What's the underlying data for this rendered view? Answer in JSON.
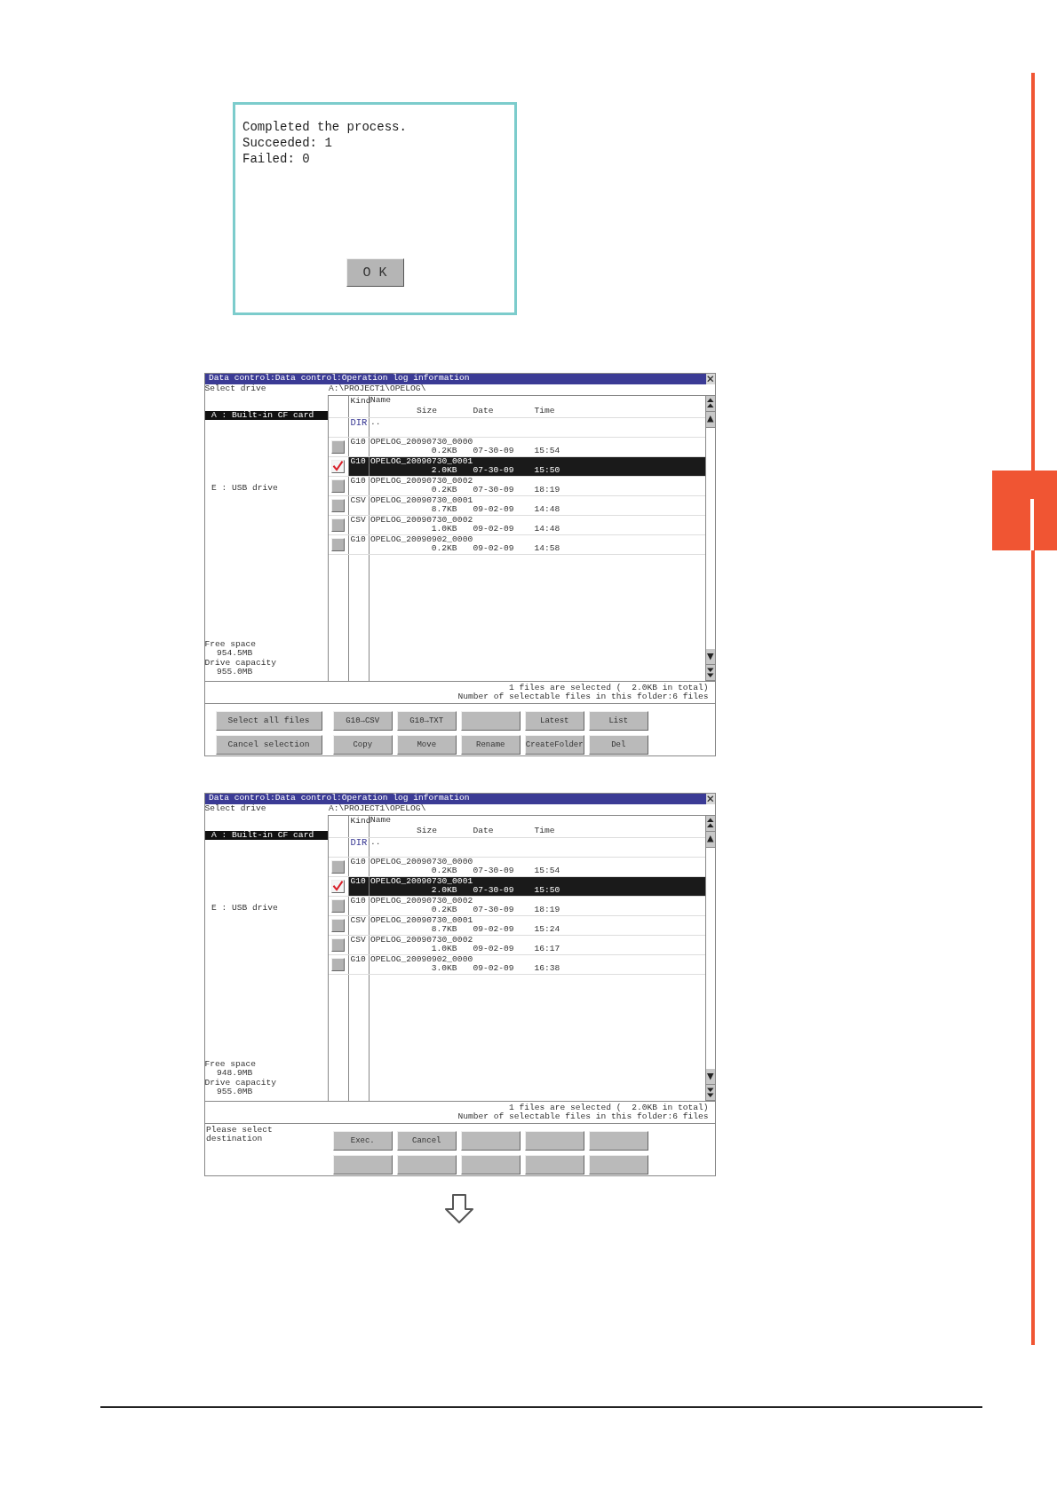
{
  "dialog": {
    "lines": [
      "Completed the process.",
      "Succeeded: 1",
      "Failed: 0"
    ],
    "button": "O K"
  },
  "screens": [
    {
      "title": "Data control:Data control:Operation log information",
      "drive_label": "Select drive",
      "path": "A:\\PROJECT1\\OPELOG\\",
      "drives": [
        {
          "label": "A : Built-in CF card",
          "selected": true
        },
        {
          "label": "E : USB drive",
          "selected": false
        }
      ],
      "free_space_label": "Free space",
      "free_space": "954.5MB",
      "capacity_label": "Drive capacity",
      "capacity": "955.0MB",
      "columns": {
        "kind": "Kind",
        "name": "Name",
        "size": "Size",
        "date": "Date",
        "time": "Time"
      },
      "dir_row": {
        "kind": "DIR",
        "name": ".."
      },
      "files": [
        {
          "kind": "G10",
          "name": "OPELOG_20090730_0000",
          "size": "0.2KB",
          "date": "07-30-09",
          "time": "15:54",
          "checked": false,
          "selected": false
        },
        {
          "kind": "G10",
          "name": "OPELOG_20090730_0001",
          "size": "2.0KB",
          "date": "07-30-09",
          "time": "15:50",
          "checked": true,
          "selected": true
        },
        {
          "kind": "G10",
          "name": "OPELOG_20090730_0002",
          "size": "0.2KB",
          "date": "07-30-09",
          "time": "18:19",
          "checked": false,
          "selected": false
        },
        {
          "kind": "CSV",
          "name": "OPELOG_20090730_0001",
          "size": "8.7KB",
          "date": "09-02-09",
          "time": "14:48",
          "checked": false,
          "selected": false
        },
        {
          "kind": "CSV",
          "name": "OPELOG_20090730_0002",
          "size": "1.0KB",
          "date": "09-02-09",
          "time": "14:48",
          "checked": false,
          "selected": false
        },
        {
          "kind": "G10",
          "name": "OPELOG_20090902_0000",
          "size": "0.2KB",
          "date": "09-02-09",
          "time": "14:58",
          "checked": false,
          "selected": false
        }
      ],
      "status_lines": [
        "1 files are selected (  2.0KB in total)",
        "Number of selectable files in this folder:6 files"
      ],
      "button_rows": [
        [
          {
            "kind": "wide",
            "label": "Select all files"
          },
          {
            "kind": "text",
            "label": "G10→CSV"
          },
          {
            "kind": "text",
            "label": "G10→TXT"
          },
          {
            "kind": "blank"
          },
          {
            "kind": "text",
            "label": "Latest"
          },
          {
            "kind": "text",
            "label": "List"
          }
        ],
        [
          {
            "kind": "wide",
            "label": "Cancel selection"
          },
          {
            "kind": "text",
            "label": "Copy"
          },
          {
            "kind": "text",
            "label": "Move"
          },
          {
            "kind": "text",
            "label": "Rename"
          },
          {
            "kind": "text",
            "label": "CreateFolder"
          },
          {
            "kind": "text",
            "label": "Del"
          }
        ]
      ]
    },
    {
      "title": "Data control:Data control:Operation log information",
      "drive_label": "Select drive",
      "path": "A:\\PROJECT1\\OPELOG\\",
      "drives": [
        {
          "label": "A : Built-in CF card",
          "selected": true
        },
        {
          "label": "E : USB drive",
          "selected": false
        }
      ],
      "free_space_label": "Free space",
      "free_space": "948.9MB",
      "capacity_label": "Drive capacity",
      "capacity": "955.0MB",
      "columns": {
        "kind": "Kind",
        "name": "Name",
        "size": "Size",
        "date": "Date",
        "time": "Time"
      },
      "dir_row": {
        "kind": "DIR",
        "name": ".."
      },
      "files": [
        {
          "kind": "G10",
          "name": "OPELOG_20090730_0000",
          "size": "0.2KB",
          "date": "07-30-09",
          "time": "15:54",
          "checked": false,
          "selected": false
        },
        {
          "kind": "G10",
          "name": "OPELOG_20090730_0001",
          "size": "2.0KB",
          "date": "07-30-09",
          "time": "15:50",
          "checked": true,
          "selected": true
        },
        {
          "kind": "G10",
          "name": "OPELOG_20090730_0002",
          "size": "0.2KB",
          "date": "07-30-09",
          "time": "18:19",
          "checked": false,
          "selected": false
        },
        {
          "kind": "CSV",
          "name": "OPELOG_20090730_0001",
          "size": "8.7KB",
          "date": "09-02-09",
          "time": "15:24",
          "checked": false,
          "selected": false
        },
        {
          "kind": "CSV",
          "name": "OPELOG_20090730_0002",
          "size": "1.0KB",
          "date": "09-02-09",
          "time": "16:17",
          "checked": false,
          "selected": false
        },
        {
          "kind": "G10",
          "name": "OPELOG_20090902_0000",
          "size": "3.0KB",
          "date": "09-02-09",
          "time": "16:38",
          "checked": false,
          "selected": false
        }
      ],
      "status_lines": [
        "1 files are selected (  2.0KB in total)",
        "Number of selectable files in this folder:6 files"
      ],
      "message": "Please select destination",
      "button_rows": [
        [
          {
            "kind": "text",
            "label": "Exec."
          },
          {
            "kind": "text",
            "label": "Cancel"
          },
          {
            "kind": "blank"
          },
          {
            "kind": "blank"
          },
          {
            "kind": "blank"
          }
        ],
        [
          {
            "kind": "blank"
          },
          {
            "kind": "blank"
          },
          {
            "kind": "blank"
          },
          {
            "kind": "blank"
          },
          {
            "kind": "blank"
          }
        ]
      ]
    }
  ]
}
